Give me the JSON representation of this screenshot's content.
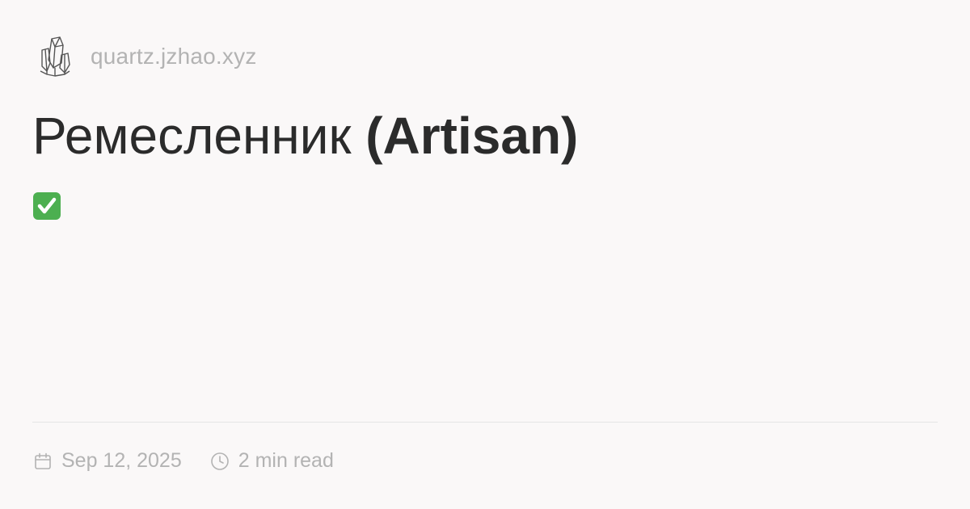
{
  "header": {
    "logo_icon": "quartz-crystal-icon",
    "site_name": "quartz.jzhao.xyz"
  },
  "page": {
    "title_regular": "Ремесленник",
    "title_bold": "(Artisan)",
    "status_icon": "check-mark-icon",
    "status_color": "#4caf50"
  },
  "meta": {
    "date_icon": "calendar-icon",
    "date": "Sep 12, 2025",
    "reading_icon": "clock-icon",
    "reading_time": "2 min read"
  },
  "colors": {
    "background": "#faf8f8",
    "text": "#2b2b2b",
    "muted": "#b3b3b3",
    "divider": "#e5e5e5"
  }
}
